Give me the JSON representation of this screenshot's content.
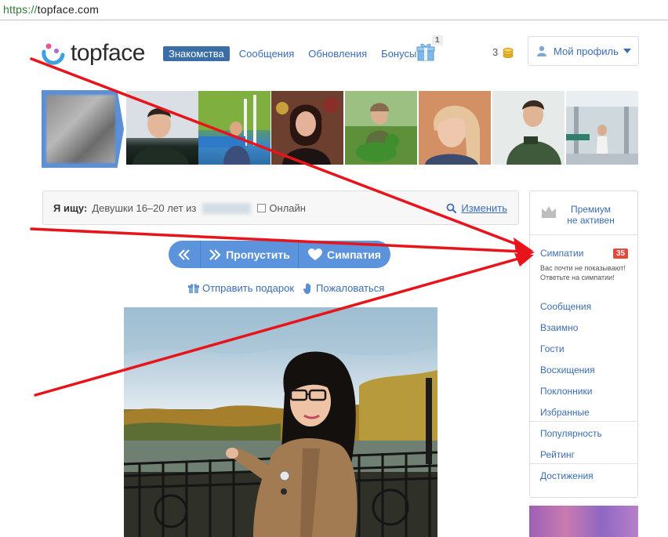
{
  "browser": {
    "url_protocol": "https://",
    "url_host": "topface.com"
  },
  "header": {
    "logo_text": "topface",
    "nav": [
      {
        "label": "Знакомства",
        "active": true
      },
      {
        "label": "Сообщения",
        "active": false
      },
      {
        "label": "Обновления",
        "active": false
      },
      {
        "label": "Бонусы",
        "active": false
      }
    ],
    "gift_count": "1",
    "coins": "3",
    "profile_label": "Мой профиль"
  },
  "search": {
    "label": "Я ищу:",
    "criteria": "Девушки  16–20 лет из",
    "online_label": "Онлайн",
    "change_label": "Изменить"
  },
  "actions": {
    "skip_label": "Пропустить",
    "like_label": "Симпатия",
    "gift_label": "Отправить подарок",
    "report_label": "Пожаловаться"
  },
  "sidebar": {
    "premium_line1": "Премиум",
    "premium_line2": "не активен",
    "likes_label": "Симпатии",
    "likes_badge": "35",
    "likes_note": "Вас почти не показывают! Ответьте на симпатии!",
    "items": [
      {
        "label": "Сообщения"
      },
      {
        "label": "Взаимно"
      },
      {
        "label": "Гости"
      },
      {
        "label": "Восхищения"
      },
      {
        "label": "Поклонники"
      },
      {
        "label": "Избранные"
      },
      {
        "label": "Популярность"
      },
      {
        "label": "Рейтинг"
      },
      {
        "label": "Достижения"
      }
    ]
  },
  "colors": {
    "accent": "#3b6db3",
    "button": "#5b93dc",
    "badge": "#e04b3b",
    "annotation_arrow": "#e8141b"
  }
}
